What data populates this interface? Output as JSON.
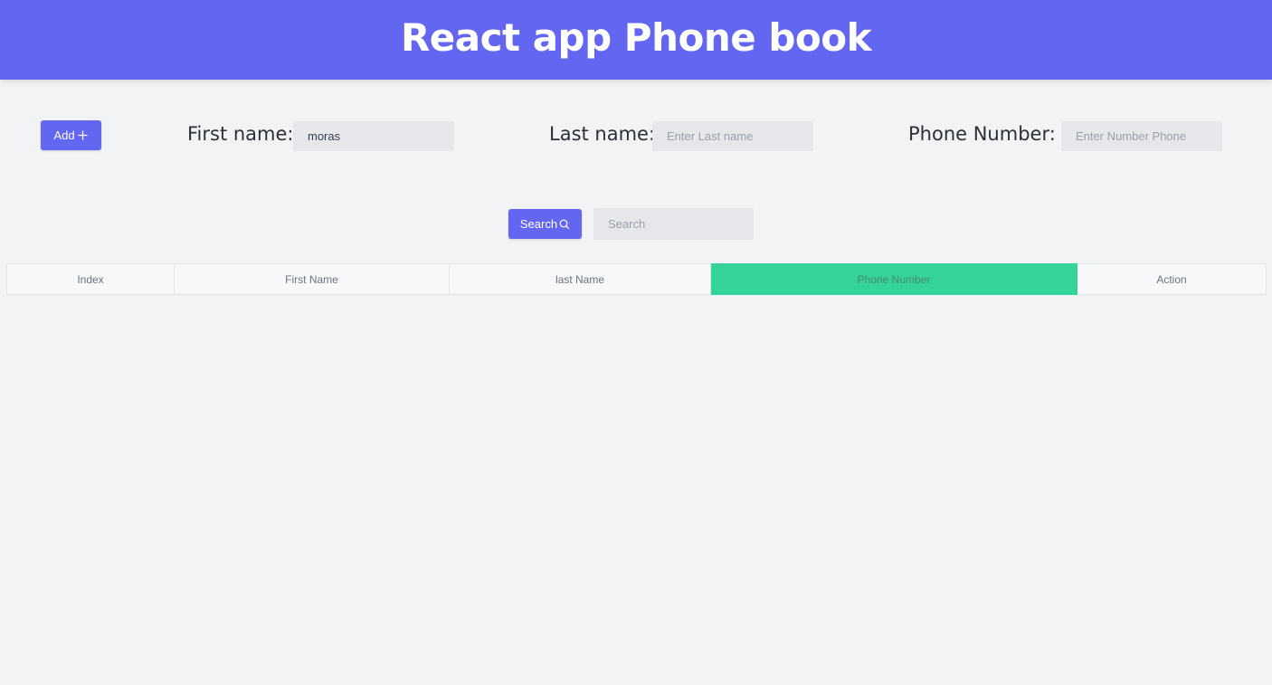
{
  "header": {
    "title": "React app Phone book"
  },
  "form": {
    "add_label": "Add",
    "first_name": {
      "label": "First name:",
      "value": "moras",
      "placeholder": ""
    },
    "last_name": {
      "label": "Last name:",
      "value": "",
      "placeholder": "Enter Last name"
    },
    "phone_number": {
      "label": "Phone Number:",
      "value": "",
      "placeholder": "Enter Number Phone"
    }
  },
  "search": {
    "button_label": "Search",
    "placeholder": "Search",
    "value": ""
  },
  "table": {
    "columns": [
      "Index",
      "First Name",
      "last Name",
      "Phone Number",
      "Action"
    ],
    "rows": []
  },
  "colors": {
    "primary": "#6366f1",
    "accent_column": "#34d399",
    "background": "#f2f3f5",
    "input_bg": "#e5e7eb"
  },
  "icons": {
    "add": "plus-icon",
    "search": "search-icon"
  }
}
